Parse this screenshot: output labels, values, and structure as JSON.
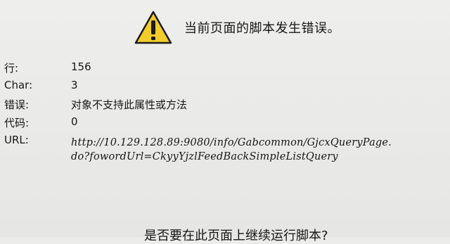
{
  "dialog": {
    "message": "当前页面的脚本发生错误。",
    "icon": "warning-icon",
    "icon_color": "#f2cd2a",
    "fields": {
      "line": {
        "label": "行:",
        "value": "156"
      },
      "char": {
        "label": "Char:",
        "value": "3"
      },
      "error": {
        "label": "错误:",
        "value": "对象不支持此属性或方法"
      },
      "code": {
        "label": "代码:",
        "value": "0"
      },
      "url": {
        "label": "URL:",
        "value_line1": "http://10.129.128.89:9080/info/Gabcommon/GjcxQueryPage.",
        "value_line2": "do?fowordUrl=CkyyYjzlFeedBackSimpleListQuery"
      }
    },
    "prompt": "是否要在此页面上继续运行脚本?"
  }
}
